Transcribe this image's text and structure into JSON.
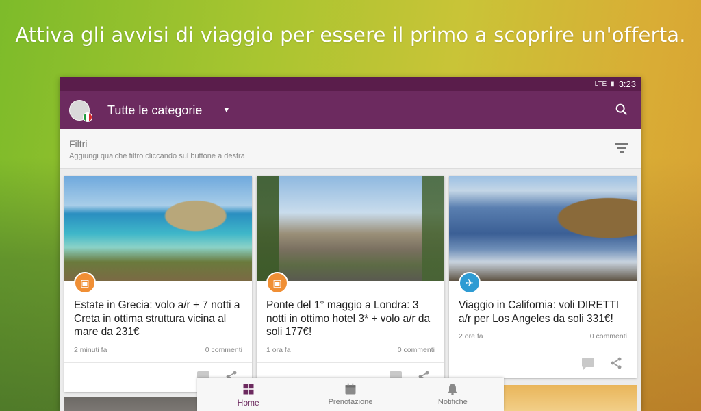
{
  "headline": "Attiva gli avvisi di viaggio per essere il primo a scoprire un'offerta.",
  "status": {
    "network": "LTE",
    "time": "3:23"
  },
  "appbar": {
    "title": "Tutte le categorie"
  },
  "filters": {
    "title": "Filtri",
    "subtitle": "Aggiungi qualche filtro cliccando sul buttone a destra"
  },
  "cards": [
    {
      "title": "Estate in Grecia: volo a/r + 7 notti a Creta in ottima struttura vicina al mare da 231€",
      "time": "2 minuti fa",
      "comments": "0 commenti",
      "badge_icon": "suitcase-icon"
    },
    {
      "title": "Ponte del 1° maggio a Londra: 3 notti in ottimo hotel 3* + volo a/r da soli 177€!",
      "time": "1 ora fa",
      "comments": "0 commenti",
      "badge_icon": "suitcase-icon"
    },
    {
      "title": "Viaggio in California: voli DIRETTI a/r per Los Angeles da soli 331€!",
      "time": "2 ore fa",
      "comments": "0 commenti",
      "badge_icon": "airplane-icon"
    }
  ],
  "bottom_nav": [
    {
      "label": "Home",
      "active": true
    },
    {
      "label": "Prenotazione",
      "active": false
    },
    {
      "label": "Notifiche",
      "active": false
    }
  ],
  "colors": {
    "primary": "#6c2a5f",
    "statusbar": "#5a1d4b",
    "badge_orange": "#f08f35",
    "badge_blue": "#2e9bd3"
  }
}
